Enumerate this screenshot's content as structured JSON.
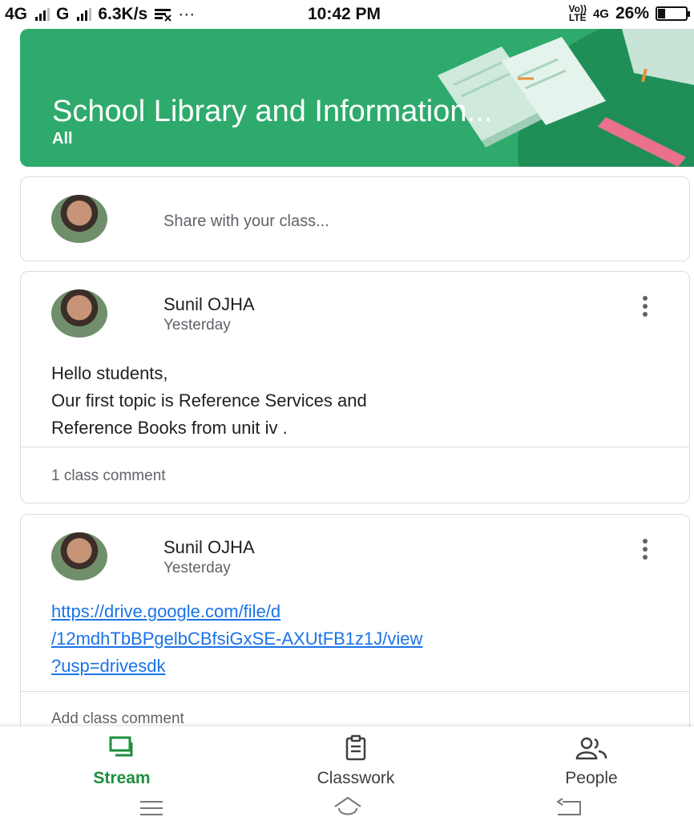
{
  "status_bar": {
    "network1": "4G",
    "network2": "G",
    "speed": "6.3K/s",
    "more": "···",
    "time": "10:42 PM",
    "volte_top": "Vo))",
    "volte_bottom": "LTE",
    "network3": "4G",
    "battery_text": "26%",
    "battery_level": 0.26
  },
  "banner": {
    "title": "School Library and Information...",
    "subtitle": "All",
    "color": "#2eaa6c"
  },
  "share": {
    "placeholder": "Share with your class..."
  },
  "posts": [
    {
      "author": "Sunil OJHA",
      "time": "Yesterday",
      "body_lines": [
        "Hello students,",
        "Our first topic is Reference Services and",
        "Reference Books from unit iv ."
      ],
      "comments": "1 class comment"
    },
    {
      "author": "Sunil OJHA",
      "time": "Yesterday",
      "link_lines": [
        "https://drive.google.com/file/d",
        "/12mdhTbBPgelbCBfsiGxSE-AXUtFB1z1J/view",
        "?usp=drivesdk"
      ],
      "add_comment": "Add class comment"
    }
  ],
  "bottom_nav": {
    "stream": "Stream",
    "classwork": "Classwork",
    "people": "People",
    "active_color": "#1e8e3e"
  },
  "icons": {
    "stream": "stream-icon",
    "classwork": "clipboard-icon",
    "people": "people-icon",
    "menu": "more-vert-icon",
    "recents": "menu-icon",
    "home": "home-icon",
    "back": "back-icon"
  }
}
